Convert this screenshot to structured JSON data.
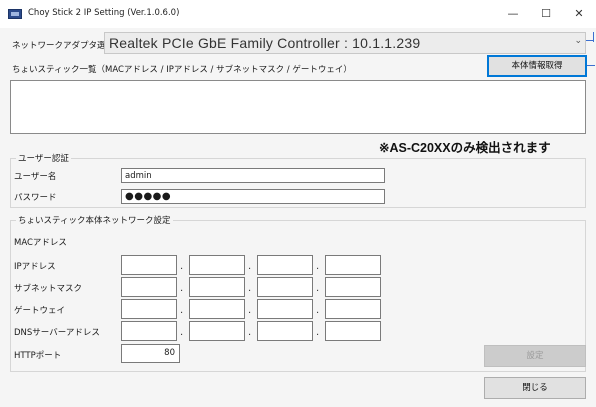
{
  "window": {
    "title": "Choy Stick 2 IP Setting (Ver.1.0.6.0)",
    "minimize_glyph": "—",
    "maximize_glyph": "☐",
    "close_glyph": "✕"
  },
  "adapter": {
    "label": "ネットワークアダプタ選択",
    "selected": "Realtek PCIe GbE Family Controller : 10.1.1.239",
    "chevron": "⌄"
  },
  "device_list": {
    "label": "ちょいスティック一覧（MACアドレス / IPアドレス / サブネットマスク / ゲートウェイ）",
    "get_info_button": "本体情報取得",
    "items": []
  },
  "note": "※AS-C20XXのみ検出されます",
  "auth": {
    "group_label": "ユーザー認証",
    "username_label": "ユーザー名",
    "username_value": "admin",
    "password_label": "パスワード",
    "password_value": "●●●●●"
  },
  "network": {
    "group_label": "ちょいスティック本体ネットワーク設定",
    "mac_label": "MACアドレス",
    "ip_label": "IPアドレス",
    "subnet_label": "サブネットマスク",
    "gateway_label": "ゲートウェイ",
    "dns_label": "DNSサーバーアドレス",
    "http_port_label": "HTTPポート",
    "http_port_value": "80",
    "octet_separator": ".",
    "set_button": "設定"
  },
  "footer": {
    "close_button": "閉じる"
  },
  "colors": {
    "accent_blue": "#3b6fd0",
    "focus_border": "#0078d7",
    "window_bg": "#f5f5f5"
  }
}
